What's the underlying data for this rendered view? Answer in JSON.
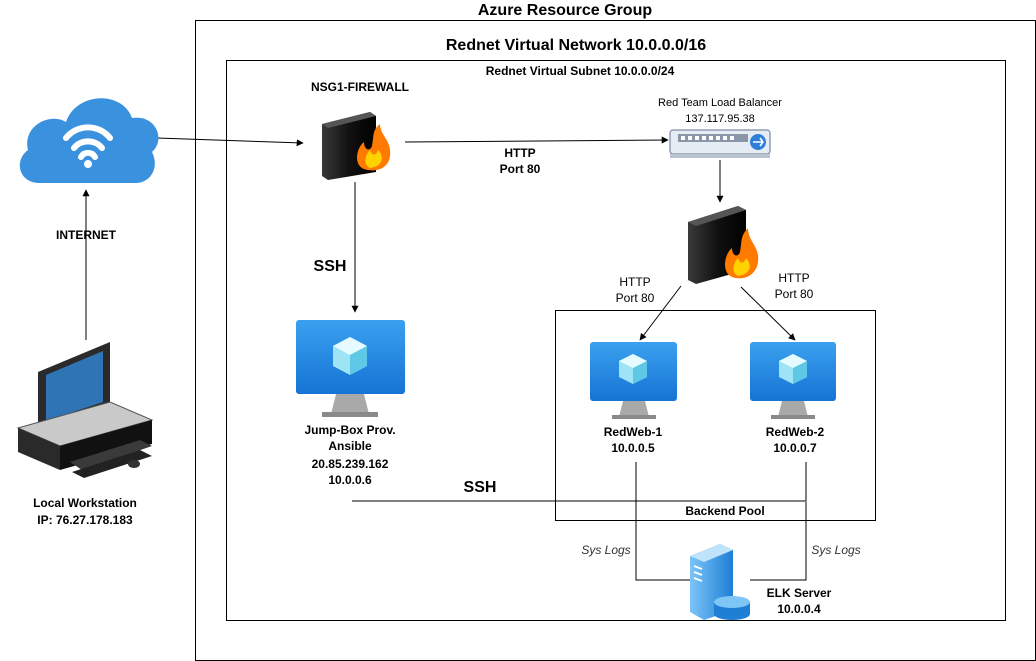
{
  "resource_group": {
    "title": "Azure Resource Group"
  },
  "vnet": {
    "title": "Rednet Virtual Network 10.0.0.0/16"
  },
  "subnet": {
    "title": "Rednet Virtual Subnet 10.0.0.0/24"
  },
  "internet": {
    "label": "INTERNET",
    "icon": "cloud-wifi-icon"
  },
  "workstation": {
    "name": "Local Workstation",
    "ip": "IP: 76.27.178.183",
    "icon": "desktop-computer-icon"
  },
  "nsg": {
    "name": "NSG1-FIREWALL",
    "icon": "firewall-icon"
  },
  "load_balancer": {
    "name": "Red Team Load Balancer",
    "ip": "137.117.95.38",
    "icon": "load-balancer-icon"
  },
  "lb_firewall": {
    "icon": "firewall-icon"
  },
  "connections": {
    "http_main": {
      "line1": "HTTP",
      "line2": "Port 80"
    },
    "http_left": {
      "line1": "HTTP",
      "line2": "Port 80"
    },
    "http_right": {
      "line1": "HTTP",
      "line2": "Port 80"
    },
    "ssh_down": "SSH",
    "ssh_across": "SSH",
    "sys_logs_left": "Sys Logs",
    "sys_logs_right": "Sys Logs"
  },
  "jumpbox": {
    "line1": "Jump-Box Prov.",
    "line2": "Ansible",
    "ip_public": "20.85.239.162",
    "ip_private": "10.0.0.6",
    "icon": "vm-monitor-icon"
  },
  "backend_pool": {
    "label": "Backend Pool"
  },
  "redweb1": {
    "name": "RedWeb-1",
    "ip": "10.0.0.5",
    "icon": "vm-monitor-icon"
  },
  "redweb2": {
    "name": "RedWeb-2",
    "ip": "10.0.0.7",
    "icon": "vm-monitor-icon"
  },
  "elk": {
    "name": "ELK Server",
    "ip": "10.0.0.4",
    "icon": "server-database-icon"
  },
  "colors": {
    "azure_blue": "#1f8be0",
    "firewall_dark": "#1a1a1a",
    "flame": "#ff7a00",
    "line": "#000000"
  }
}
